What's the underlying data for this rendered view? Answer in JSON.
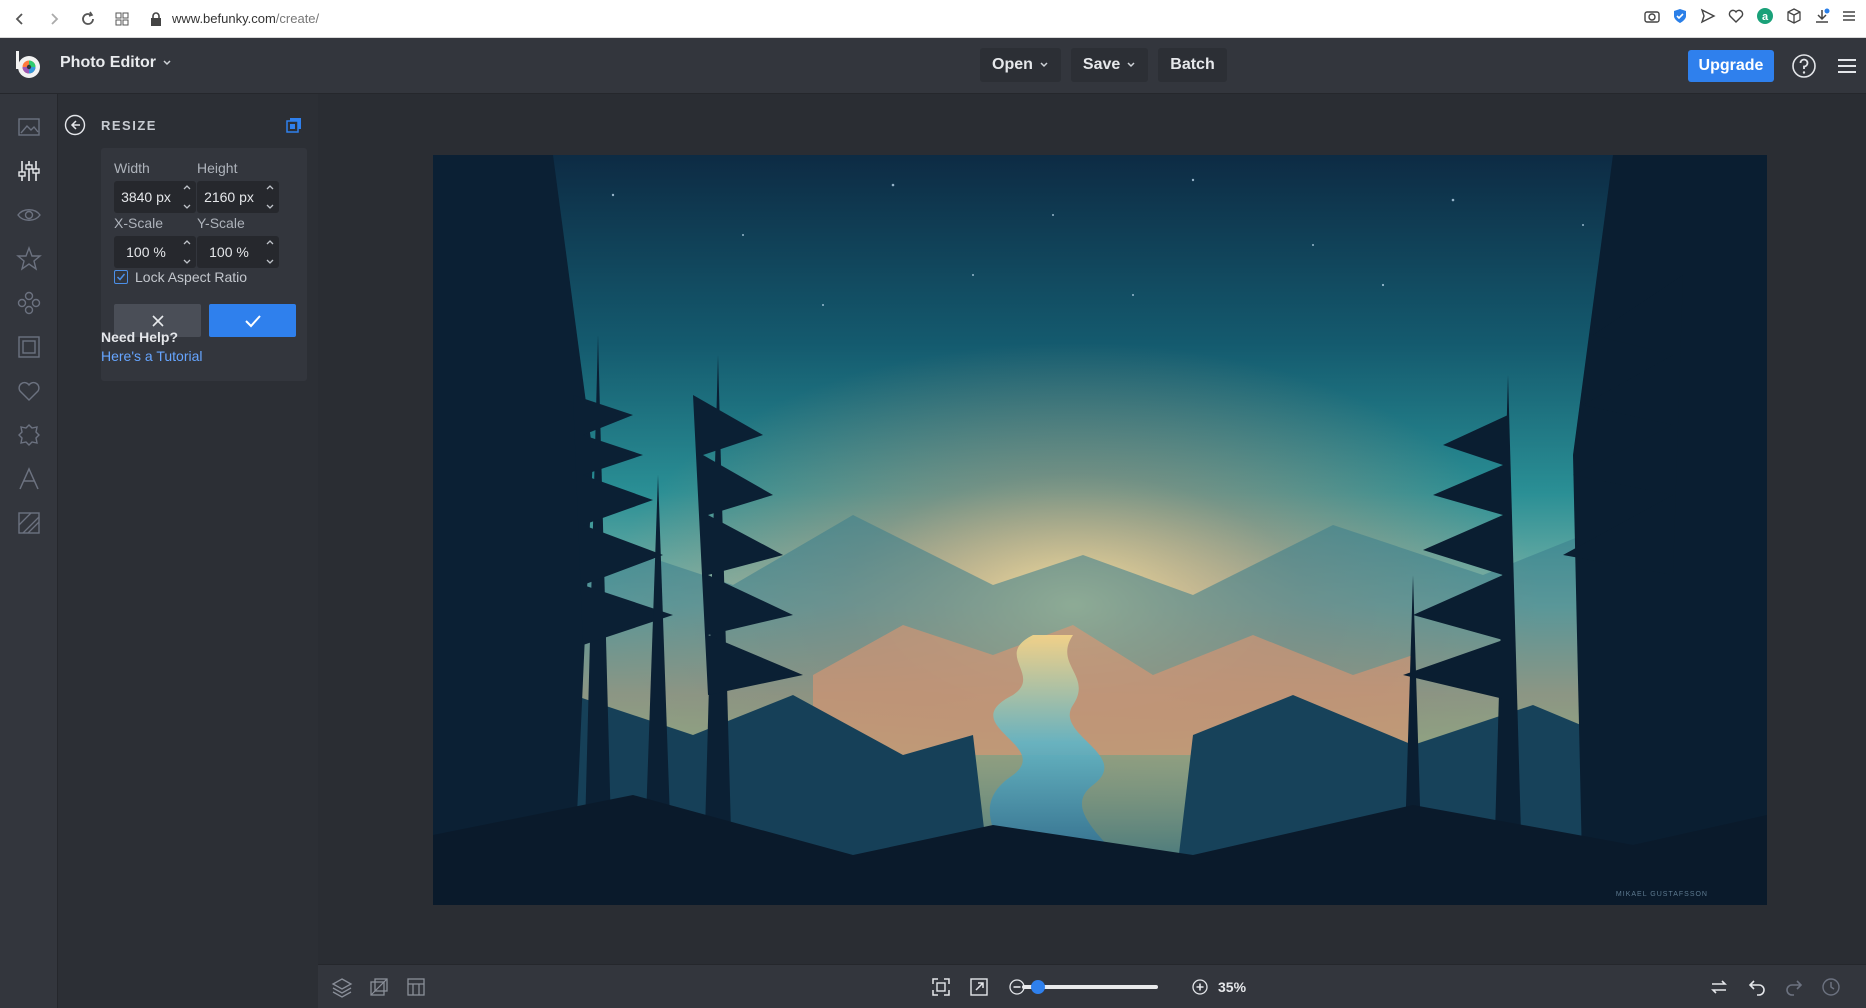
{
  "browser": {
    "url_domain": "www.befunky.com",
    "url_path": "/create/"
  },
  "app": {
    "title": "Photo Editor",
    "menu": [
      "Open",
      "Save",
      "Batch"
    ],
    "upgrade_label": "Upgrade"
  },
  "rail": {
    "items": [
      "edit-icon",
      "adjust-icon",
      "touch-up-icon",
      "effects-icon",
      "artsy-icon",
      "frames-icon",
      "graphics-icon",
      "overlays-icon",
      "text-icon",
      "textures-icon"
    ]
  },
  "panel": {
    "title": "RESIZE",
    "width_label": "Width",
    "width_value": "3840 px",
    "height_label": "Height",
    "height_value": "2160 px",
    "xscale_label": "X-Scale",
    "xscale_value": "100 %",
    "yscale_label": "Y-Scale",
    "yscale_value": "100 %",
    "lock_label": "Lock Aspect Ratio",
    "lock_checked": true,
    "help_title": "Need Help?",
    "help_link": "Here's a Tutorial"
  },
  "canvas": {
    "watermark": "MIKAEL GUSTAFSSON"
  },
  "bottombar": {
    "zoom_percent_label": "35%",
    "zoom_level": 0.35
  },
  "colors": {
    "accent": "#2f80ed",
    "panel_bg": "#2c2f35",
    "header_bg": "#33363d"
  }
}
